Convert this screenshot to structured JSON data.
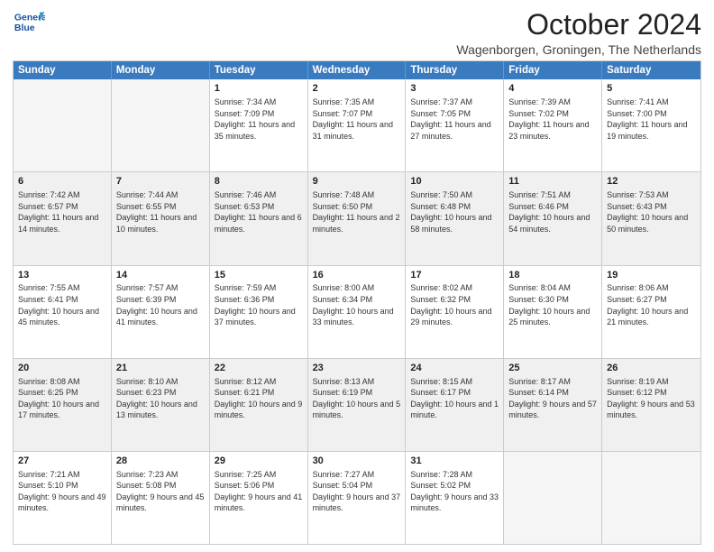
{
  "logo": {
    "line1": "General",
    "line2": "Blue"
  },
  "title": "October 2024",
  "subtitle": "Wagenborgen, Groningen, The Netherlands",
  "headers": [
    "Sunday",
    "Monday",
    "Tuesday",
    "Wednesday",
    "Thursday",
    "Friday",
    "Saturday"
  ],
  "rows": [
    [
      {
        "day": "",
        "info": "",
        "empty": true
      },
      {
        "day": "",
        "info": "",
        "empty": true
      },
      {
        "day": "1",
        "info": "Sunrise: 7:34 AM\nSunset: 7:09 PM\nDaylight: 11 hours and 35 minutes."
      },
      {
        "day": "2",
        "info": "Sunrise: 7:35 AM\nSunset: 7:07 PM\nDaylight: 11 hours and 31 minutes."
      },
      {
        "day": "3",
        "info": "Sunrise: 7:37 AM\nSunset: 7:05 PM\nDaylight: 11 hours and 27 minutes."
      },
      {
        "day": "4",
        "info": "Sunrise: 7:39 AM\nSunset: 7:02 PM\nDaylight: 11 hours and 23 minutes."
      },
      {
        "day": "5",
        "info": "Sunrise: 7:41 AM\nSunset: 7:00 PM\nDaylight: 11 hours and 19 minutes."
      }
    ],
    [
      {
        "day": "6",
        "info": "Sunrise: 7:42 AM\nSunset: 6:57 PM\nDaylight: 11 hours and 14 minutes."
      },
      {
        "day": "7",
        "info": "Sunrise: 7:44 AM\nSunset: 6:55 PM\nDaylight: 11 hours and 10 minutes."
      },
      {
        "day": "8",
        "info": "Sunrise: 7:46 AM\nSunset: 6:53 PM\nDaylight: 11 hours and 6 minutes."
      },
      {
        "day": "9",
        "info": "Sunrise: 7:48 AM\nSunset: 6:50 PM\nDaylight: 11 hours and 2 minutes."
      },
      {
        "day": "10",
        "info": "Sunrise: 7:50 AM\nSunset: 6:48 PM\nDaylight: 10 hours and 58 minutes."
      },
      {
        "day": "11",
        "info": "Sunrise: 7:51 AM\nSunset: 6:46 PM\nDaylight: 10 hours and 54 minutes."
      },
      {
        "day": "12",
        "info": "Sunrise: 7:53 AM\nSunset: 6:43 PM\nDaylight: 10 hours and 50 minutes."
      }
    ],
    [
      {
        "day": "13",
        "info": "Sunrise: 7:55 AM\nSunset: 6:41 PM\nDaylight: 10 hours and 45 minutes."
      },
      {
        "day": "14",
        "info": "Sunrise: 7:57 AM\nSunset: 6:39 PM\nDaylight: 10 hours and 41 minutes."
      },
      {
        "day": "15",
        "info": "Sunrise: 7:59 AM\nSunset: 6:36 PM\nDaylight: 10 hours and 37 minutes."
      },
      {
        "day": "16",
        "info": "Sunrise: 8:00 AM\nSunset: 6:34 PM\nDaylight: 10 hours and 33 minutes."
      },
      {
        "day": "17",
        "info": "Sunrise: 8:02 AM\nSunset: 6:32 PM\nDaylight: 10 hours and 29 minutes."
      },
      {
        "day": "18",
        "info": "Sunrise: 8:04 AM\nSunset: 6:30 PM\nDaylight: 10 hours and 25 minutes."
      },
      {
        "day": "19",
        "info": "Sunrise: 8:06 AM\nSunset: 6:27 PM\nDaylight: 10 hours and 21 minutes."
      }
    ],
    [
      {
        "day": "20",
        "info": "Sunrise: 8:08 AM\nSunset: 6:25 PM\nDaylight: 10 hours and 17 minutes."
      },
      {
        "day": "21",
        "info": "Sunrise: 8:10 AM\nSunset: 6:23 PM\nDaylight: 10 hours and 13 minutes."
      },
      {
        "day": "22",
        "info": "Sunrise: 8:12 AM\nSunset: 6:21 PM\nDaylight: 10 hours and 9 minutes."
      },
      {
        "day": "23",
        "info": "Sunrise: 8:13 AM\nSunset: 6:19 PM\nDaylight: 10 hours and 5 minutes."
      },
      {
        "day": "24",
        "info": "Sunrise: 8:15 AM\nSunset: 6:17 PM\nDaylight: 10 hours and 1 minute."
      },
      {
        "day": "25",
        "info": "Sunrise: 8:17 AM\nSunset: 6:14 PM\nDaylight: 9 hours and 57 minutes."
      },
      {
        "day": "26",
        "info": "Sunrise: 8:19 AM\nSunset: 6:12 PM\nDaylight: 9 hours and 53 minutes."
      }
    ],
    [
      {
        "day": "27",
        "info": "Sunrise: 7:21 AM\nSunset: 5:10 PM\nDaylight: 9 hours and 49 minutes."
      },
      {
        "day": "28",
        "info": "Sunrise: 7:23 AM\nSunset: 5:08 PM\nDaylight: 9 hours and 45 minutes."
      },
      {
        "day": "29",
        "info": "Sunrise: 7:25 AM\nSunset: 5:06 PM\nDaylight: 9 hours and 41 minutes."
      },
      {
        "day": "30",
        "info": "Sunrise: 7:27 AM\nSunset: 5:04 PM\nDaylight: 9 hours and 37 minutes."
      },
      {
        "day": "31",
        "info": "Sunrise: 7:28 AM\nSunset: 5:02 PM\nDaylight: 9 hours and 33 minutes."
      },
      {
        "day": "",
        "info": "",
        "empty": true
      },
      {
        "day": "",
        "info": "",
        "empty": true
      }
    ]
  ]
}
